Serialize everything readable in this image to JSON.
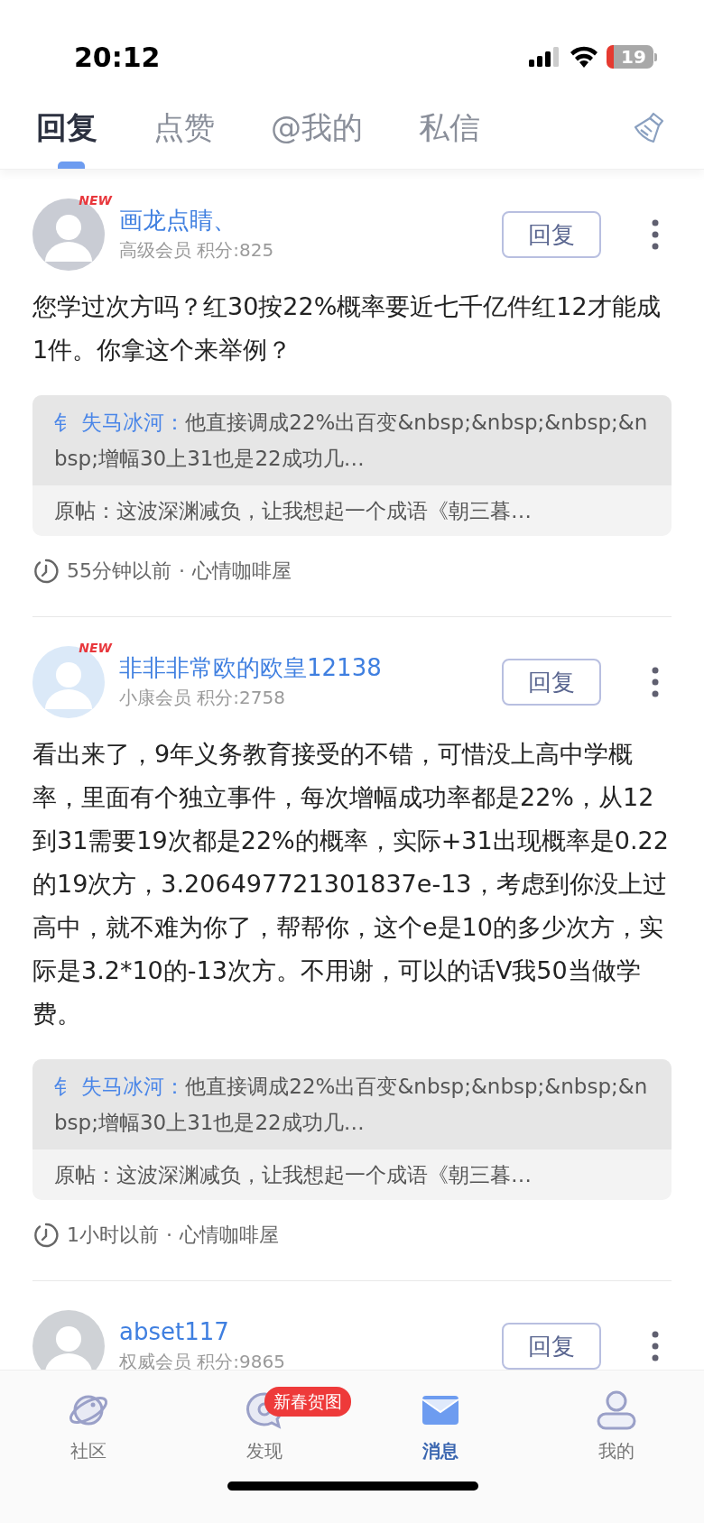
{
  "status_bar": {
    "time": "20:12",
    "battery": "19"
  },
  "tabs": [
    {
      "label": "回复",
      "selected": true
    },
    {
      "label": "点赞",
      "selected": false
    },
    {
      "label": "@我的",
      "selected": false
    },
    {
      "label": "私信",
      "selected": false
    }
  ],
  "posts": [
    {
      "user": "画龙点睛、",
      "badge": "NEW",
      "member": "高级会员",
      "points": "积分:825",
      "reply_button": "回复",
      "body": "您学过次方吗？红30按22%概率要近七千亿件红12才能成1件。你拿这个来举例？",
      "quote": {
        "author": "钅 失马冰河：",
        "text": "他直接调成22%出百变&nbsp;&nbsp;&nbsp;&nbsp;增幅30上31也是22成功几…",
        "original": "原帖：这波深渊减负，让我想起一个成语《朝三暮…"
      },
      "time": "55分钟以前",
      "separator": "·",
      "forum": "心情咖啡屋"
    },
    {
      "user": "非非非常欧的欧皇12138",
      "badge": "NEW",
      "member": "小康会员",
      "points": "积分:2758",
      "reply_button": "回复",
      "body": "看出来了，9年义务教育接受的不错，可惜没上高中学概率，里面有个独立事件，每次增幅成功率都是22%，从12到31需要19次都是22%的概率，实际+31出现概率是0.22的19次方，3.206497721301837e-13，考虑到你没上过高中，就不难为你了，帮帮你，这个e是10的多少次方，实际是3.2*10的-13次方。不用谢，可以的话V我50当做学费。",
      "quote": {
        "author": "钅 失马冰河：",
        "text": "他直接调成22%出百变&nbsp;&nbsp;&nbsp;&nbsp;增幅30上31也是22成功几…",
        "original": "原帖：这波深渊减负，让我想起一个成语《朝三暮…"
      },
      "time": "1小时以前",
      "separator": "·",
      "forum": "心情咖啡屋"
    },
    {
      "user": "abset117",
      "member": "权威会员",
      "points": "积分:9865",
      "reply_button": "回复"
    }
  ],
  "nav": [
    {
      "label": "社区",
      "kind": "planet",
      "selected": false
    },
    {
      "label": "发现",
      "kind": "chat",
      "selected": false,
      "badge": "新春贺图"
    },
    {
      "label": "消息",
      "kind": "mail",
      "selected": true
    },
    {
      "label": "我的",
      "kind": "person",
      "selected": false
    }
  ]
}
